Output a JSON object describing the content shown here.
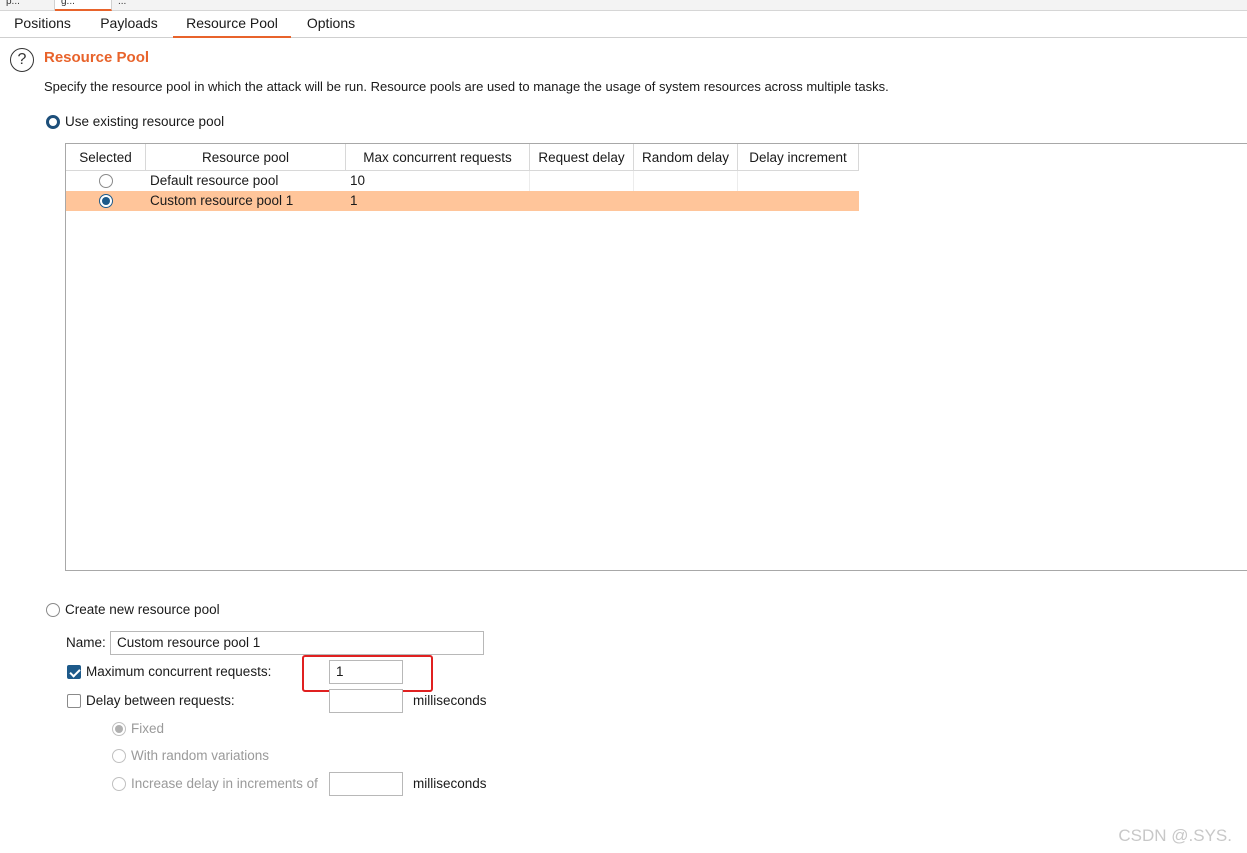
{
  "top_strip": {
    "tabs": [
      "p...",
      "g...",
      "..."
    ]
  },
  "tabs": [
    {
      "label": "Positions",
      "active": false
    },
    {
      "label": "Payloads",
      "active": false
    },
    {
      "label": "Resource Pool",
      "active": true
    },
    {
      "label": "Options",
      "active": false
    }
  ],
  "section": {
    "title": "Resource Pool",
    "help_icon": "question-circle-icon",
    "description": "Specify the resource pool in which the attack will be run. Resource pools are used to manage the usage of system resources across multiple tasks."
  },
  "use_existing": {
    "label": "Use existing resource pool",
    "selected": true
  },
  "table": {
    "columns": [
      "Selected",
      "Resource pool",
      "Max concurrent requests",
      "Request delay",
      "Random delay",
      "Delay increment"
    ],
    "rows": [
      {
        "selected": false,
        "name": "Default resource pool",
        "max_concurrent": "10",
        "request_delay": "",
        "random_delay": "",
        "delay_increment": ""
      },
      {
        "selected": true,
        "name": "Custom resource pool 1",
        "max_concurrent": "1",
        "request_delay": "",
        "random_delay": "",
        "delay_increment": ""
      }
    ]
  },
  "create_new": {
    "label": "Create new resource pool",
    "selected": false,
    "name_label": "Name:",
    "name_value": "Custom resource pool 1",
    "max_concurrent": {
      "label": "Maximum concurrent requests:",
      "checked": true,
      "value": "1"
    },
    "delay_between": {
      "label": "Delay between requests:",
      "checked": false,
      "value": "",
      "unit": "milliseconds"
    },
    "delay_options": [
      {
        "label": "Fixed",
        "selected": true
      },
      {
        "label": "With random variations",
        "selected": false
      },
      {
        "label": "Increase delay in increments of",
        "selected": false
      }
    ],
    "increment_value": "",
    "increment_unit": "milliseconds"
  },
  "watermark": "CSDN @.SYS.",
  "colors": {
    "accent": "#e8632b",
    "selected_row": "#ffc59a",
    "highlight_box": "#e02020",
    "radio_checked": "#1d5a8a"
  }
}
